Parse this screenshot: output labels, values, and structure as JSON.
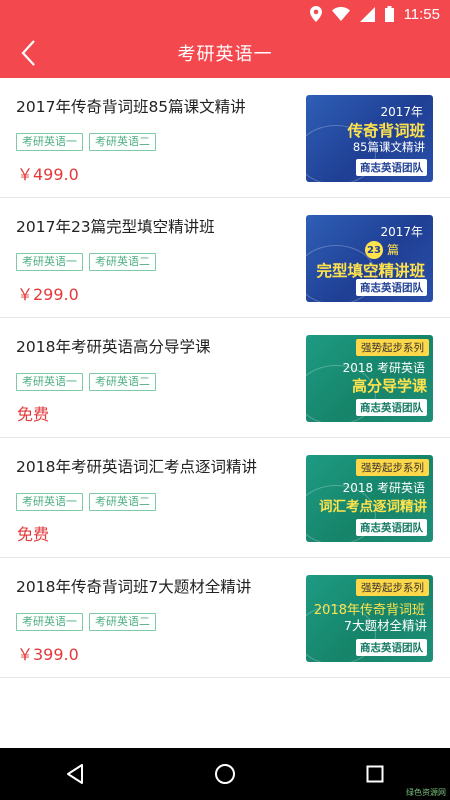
{
  "status_bar": {
    "time": "11:55",
    "icons": [
      "location-icon",
      "wifi-icon",
      "signal-icon",
      "battery-icon"
    ]
  },
  "header": {
    "title": "考研英语一",
    "back_icon": "chevron-left-icon"
  },
  "colors": {
    "accent": "#f4484f",
    "price": "#e4393c",
    "tag": "#4caf82"
  },
  "items": [
    {
      "name": "2017年传奇背词班85篇课文精讲",
      "tags": [
        "考研英语一",
        "考研英语二"
      ],
      "price": "￥499.0",
      "thumb": {
        "style": "blue",
        "line1": "2017年",
        "line2": "传奇背词班",
        "line3": "85篇课文精讲",
        "team": "商志英语团队"
      }
    },
    {
      "name": "2017年23篇完型填空精讲班",
      "tags": [
        "考研英语一",
        "考研英语二"
      ],
      "price": "￥299.0",
      "thumb": {
        "style": "blue",
        "line1": "2017年",
        "badge": "23",
        "badge_suffix": "篇",
        "line2": "完型填空精讲班",
        "team": "商志英语团队"
      }
    },
    {
      "name": "2018年考研英语高分导学课",
      "tags": [
        "考研英语一",
        "考研英语二"
      ],
      "price": "免费",
      "thumb": {
        "style": "green",
        "series": "强势起步系列",
        "year": "2018 考研英语",
        "big": "高分导学课",
        "team": "商志英语团队"
      }
    },
    {
      "name": "2018年考研英语词汇考点逐词精讲",
      "tags": [
        "考研英语一",
        "考研英语二"
      ],
      "price": "免费",
      "thumb": {
        "style": "green",
        "series": "强势起步系列",
        "year": "2018 考研英语",
        "big": "词汇考点逐词精讲",
        "team": "商志英语团队"
      }
    },
    {
      "name": "2018年传奇背词班7大题材全精讲",
      "tags": [
        "考研英语一",
        "考研英语二"
      ],
      "price": "￥399.0",
      "thumb": {
        "style": "green",
        "series": "强势起步系列",
        "year": "2018年传奇背词班",
        "big": "7大题材全精讲",
        "team": "商志英语团队"
      }
    }
  ],
  "nav": {
    "back_icon": "triangle-back-icon",
    "home_icon": "circle-home-icon",
    "recents_icon": "square-recents-icon"
  },
  "watermark": "绿色资源网"
}
